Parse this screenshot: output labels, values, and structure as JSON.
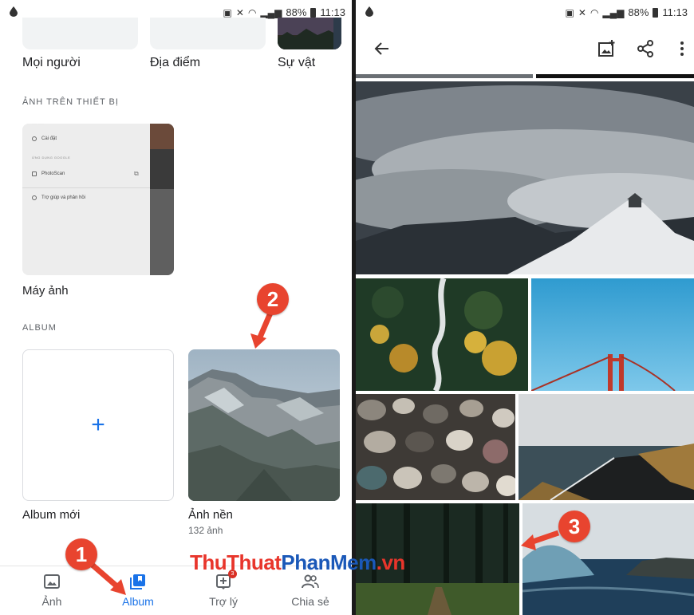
{
  "left_screen": {
    "status": {
      "signal": "88%",
      "time": "11:13"
    },
    "categories": [
      {
        "label": "Mọi người"
      },
      {
        "label": "Địa điểm"
      },
      {
        "label": "Sự vật"
      }
    ],
    "device_section": {
      "heading": "ẢNH TRÊN THIẾT BỊ",
      "card_label": "Máy ảnh",
      "menu": {
        "settings": "Cài đặt",
        "sub_heading": "ỨNG DỤNG GOOGLE",
        "photoscan": "PhotoScan",
        "help": "Trợ giúp và phản hồi"
      }
    },
    "album_section": {
      "heading": "ALBUM",
      "new_album_label": "Album mới",
      "wallpaper_label": "Ảnh nền",
      "wallpaper_count": "132 ảnh"
    },
    "bottom_nav": [
      {
        "label": "Ảnh",
        "icon": "photo-icon",
        "active": false
      },
      {
        "label": "Album",
        "icon": "album-icon",
        "active": true
      },
      {
        "label": "Trợ lý",
        "icon": "assistant-icon",
        "active": false,
        "badge": "3"
      },
      {
        "label": "Chia sẻ",
        "icon": "people-icon",
        "active": false
      }
    ]
  },
  "right_screen": {
    "status": {
      "signal": "88%",
      "time": "11:13"
    },
    "toolbar_icons": [
      "back-arrow-icon",
      "add-photo-icon",
      "share-icon",
      "more-vert-icon"
    ]
  },
  "annotations": {
    "markers": [
      "1",
      "2",
      "3"
    ],
    "watermark": {
      "part1": "Thu",
      "part2": "Thuat",
      "part3": "PhanMem",
      "part4": ".vn"
    }
  },
  "colors": {
    "accent": "#1a73e8",
    "marker": "#e8442f",
    "badge": "#d93025"
  }
}
